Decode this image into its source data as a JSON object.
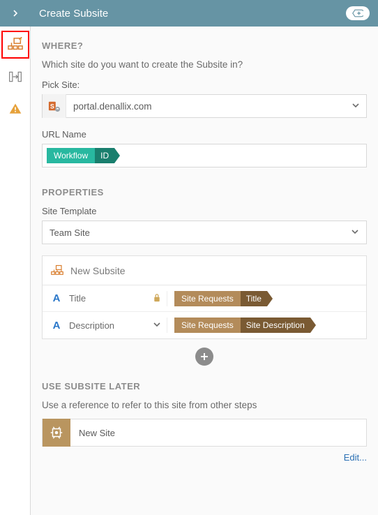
{
  "header": {
    "title": "Create Subsite"
  },
  "where": {
    "section_label": "WHERE?",
    "help": "Which site do you want to create the Subsite in?",
    "pick_label": "Pick Site:",
    "site_value": "portal.denallix.com",
    "url_label": "URL Name",
    "url_token": {
      "left": "Workflow",
      "right": "ID"
    }
  },
  "properties": {
    "section_label": "PROPERTIES",
    "template_label": "Site Template",
    "template_value": "Team Site",
    "head": "New Subsite",
    "rows": [
      {
        "label": "Title",
        "token_left": "Site Requests",
        "token_right": "Title",
        "locked": true
      },
      {
        "label": "Description",
        "token_left": "Site Requests",
        "token_right": "Site Description",
        "expandable": true
      }
    ]
  },
  "use_later": {
    "section_label": "USE SUBSITE LATER",
    "help": "Use a reference to refer to this site from other steps",
    "ref_value": "New Site",
    "edit": "Edit..."
  }
}
